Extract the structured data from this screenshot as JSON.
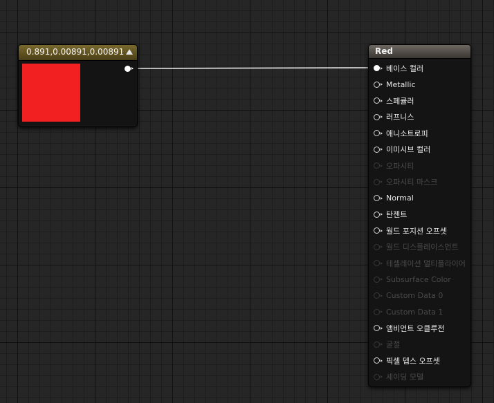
{
  "constant_node": {
    "title": "0.891,0.00891,0.00891",
    "color": "#f22020"
  },
  "material_node": {
    "title": "Red",
    "inputs": [
      {
        "label": "베이스 컬러",
        "state": "connected"
      },
      {
        "label": "Metallic",
        "state": "enabled"
      },
      {
        "label": "스페큘러",
        "state": "enabled"
      },
      {
        "label": "러프니스",
        "state": "enabled"
      },
      {
        "label": "애니소트로피",
        "state": "enabled"
      },
      {
        "label": "이미시브 컬러",
        "state": "enabled"
      },
      {
        "label": "오파시티",
        "state": "disabled"
      },
      {
        "label": "오파시티 마스크",
        "state": "disabled"
      },
      {
        "label": "Normal",
        "state": "enabled"
      },
      {
        "label": "탄젠트",
        "state": "enabled"
      },
      {
        "label": "월드 포지션 오프셋",
        "state": "enabled"
      },
      {
        "label": "월드 디스플레이스먼트",
        "state": "disabled"
      },
      {
        "label": "테셀레이션 멀티플라이어",
        "state": "disabled"
      },
      {
        "label": "Subsurface Color",
        "state": "disabled"
      },
      {
        "label": "Custom Data 0",
        "state": "disabled"
      },
      {
        "label": "Custom Data 1",
        "state": "disabled"
      },
      {
        "label": "앰비언트 오클루전",
        "state": "enabled"
      },
      {
        "label": "굴절",
        "state": "disabled"
      },
      {
        "label": "픽셀 뎁스 오프셋",
        "state": "enabled"
      },
      {
        "label": "셰이딩 모델",
        "state": "disabled"
      }
    ]
  }
}
